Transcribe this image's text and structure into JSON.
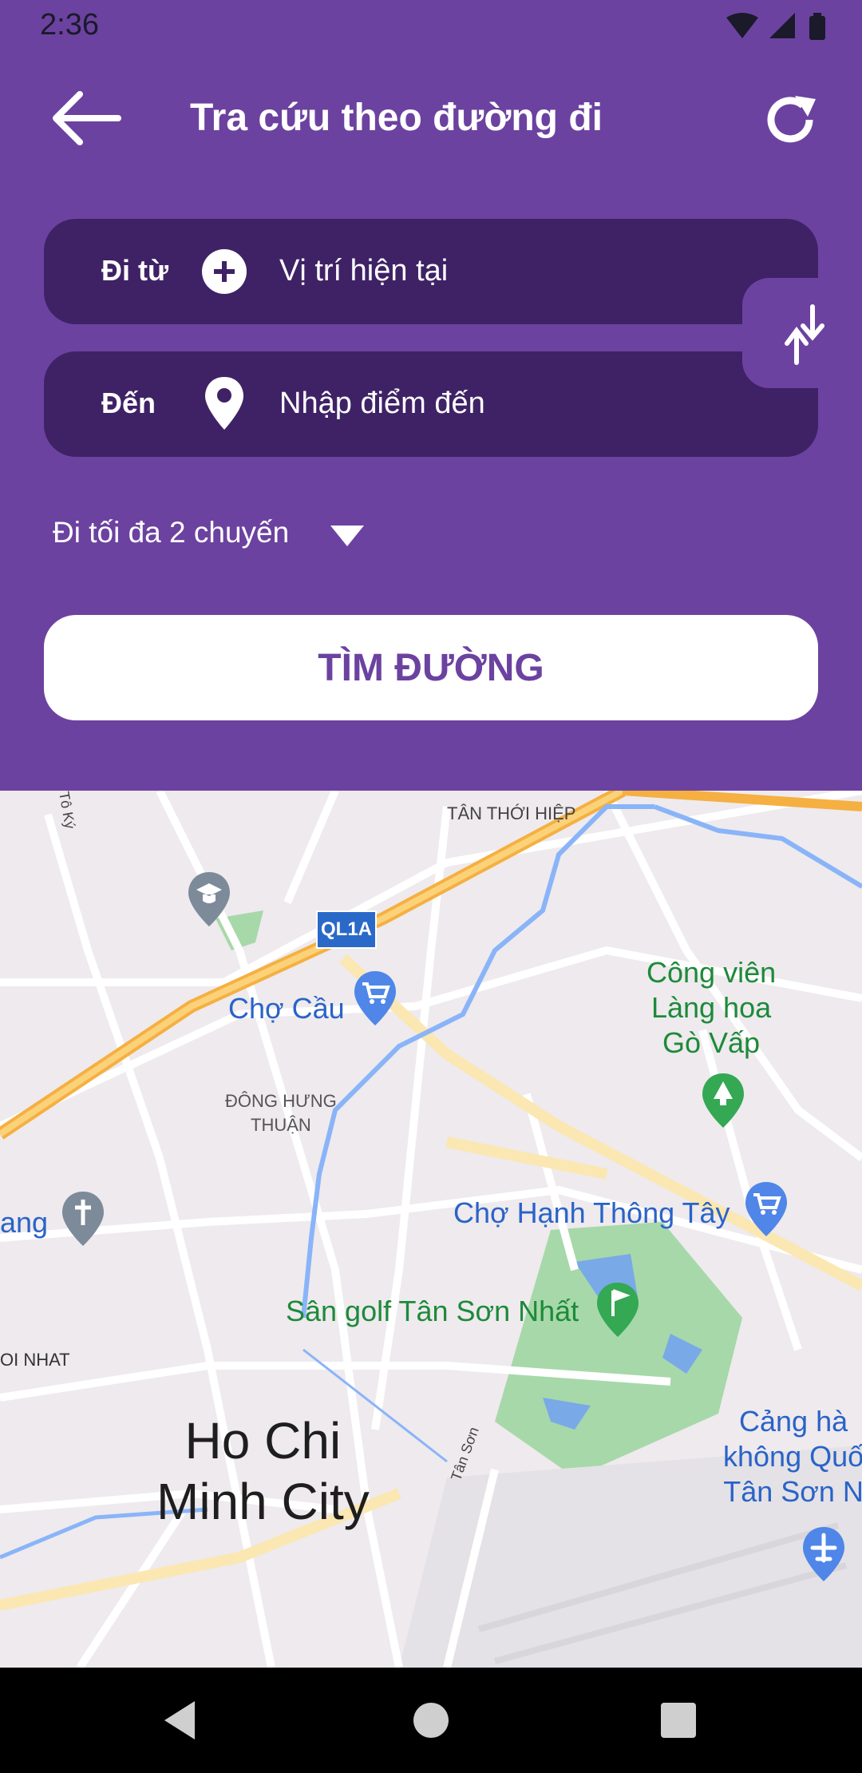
{
  "status_bar": {
    "time": "2:36"
  },
  "header": {
    "title": "Tra cứu theo đường đi"
  },
  "form": {
    "from_label": "Đi từ",
    "from_value": "Vị trí hiện tại",
    "to_label": "Đến",
    "to_placeholder": "Nhập điểm đến",
    "max_trips": "Đi tối đa 2 chuyến",
    "search_button": "TÌM ĐƯỜNG"
  },
  "map": {
    "labels": {
      "tan_thoi_hiep": "TÂN THỚI HIỆP",
      "to_ky": "Tô Ký",
      "ql1a": "QL1A",
      "cho_cau": "Chợ Cầu",
      "cong_vien": "Công viên\nLàng hoa\nGò Vấp",
      "dong_hung_thuan": "ĐÔNG HƯNG\nTHUẬN",
      "cho_hanh_thong_tay": "Chợ Hạnh Thông Tây",
      "ang": "ang",
      "san_golf": "Sân golf Tân Sơn Nhất",
      "oi_nhat": "OI NHAT",
      "tan_son": "Tân Sơn",
      "city": "Ho Chi\nMinh City",
      "airport": "Cảng hà\nkhông Quố\nTân Sơn N"
    }
  },
  "colors": {
    "primary": "#6c42a0",
    "field_bg": "#3f2266",
    "accent_white": "#ffffff"
  }
}
